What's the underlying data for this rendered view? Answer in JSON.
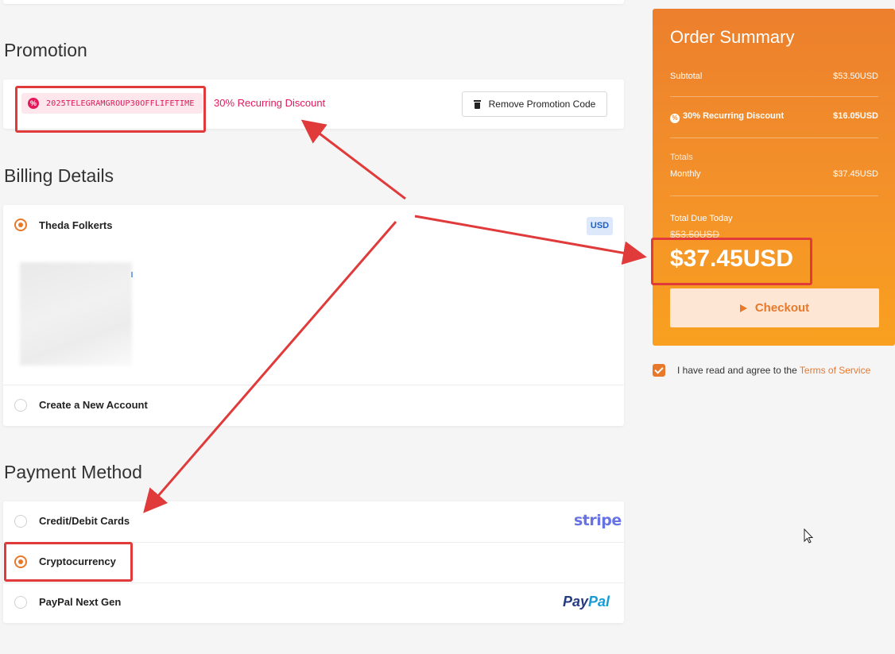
{
  "promotion": {
    "title": "Promotion",
    "code": "2025TELEGRAMGROUP30OFFLIFETIME",
    "discount_label": "30% Recurring Discount",
    "remove_label": "Remove Promotion Code",
    "badge_glyph": "%"
  },
  "billing": {
    "title": "Billing Details",
    "options": [
      {
        "label": "Theda Folkerts",
        "selected": true
      },
      {
        "label": "Create a New Account",
        "selected": false
      }
    ],
    "currency_badge": "USD"
  },
  "payment": {
    "title": "Payment Method",
    "options": [
      {
        "label": "Credit/Debit Cards",
        "selected": false,
        "logo": "stripe"
      },
      {
        "label": "Cryptocurrency",
        "selected": true
      },
      {
        "label": "PayPal Next Gen",
        "selected": false,
        "logo_pay": "Pay",
        "logo_pal": "Pal"
      }
    ]
  },
  "summary": {
    "title": "Order Summary",
    "subtotal_label": "Subtotal",
    "subtotal_value": "$53.50USD",
    "discount_label": "30% Recurring Discount",
    "discount_value": "$16.05USD",
    "totals_label": "Totals",
    "monthly_label": "Monthly",
    "monthly_value": "$37.45USD",
    "due_label": "Total Due Today",
    "old_total": "$53.50USD",
    "total": "$37.45USD",
    "checkout_label": "Checkout"
  },
  "tos": {
    "text": "I have read and agree to the",
    "link": "Terms of Service",
    "checked": true
  },
  "colors": {
    "accent": "#e8782a",
    "promo_pink": "#e0195b",
    "annotation_red": "#e03a3a"
  }
}
